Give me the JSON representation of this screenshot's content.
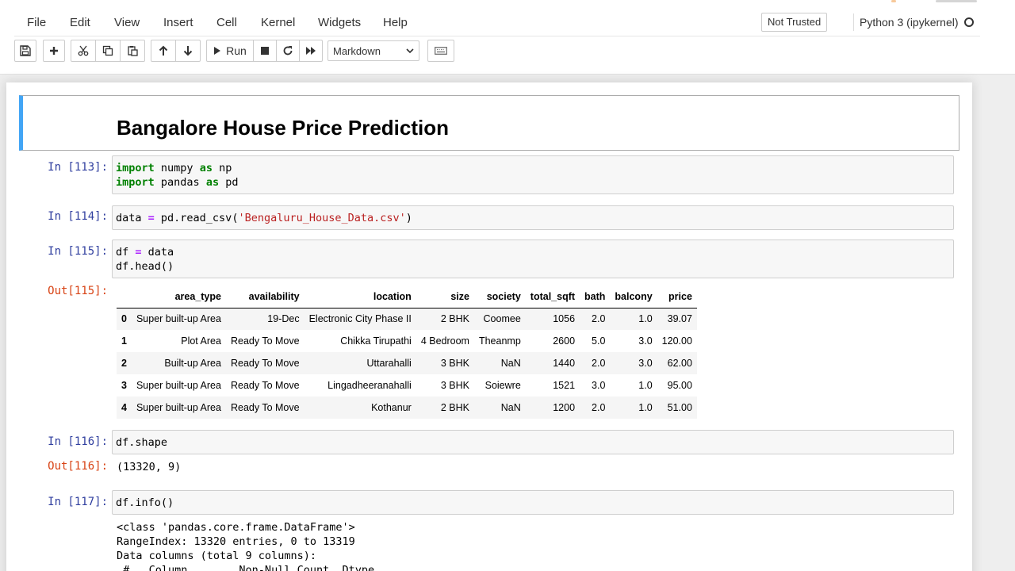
{
  "menu": [
    "File",
    "Edit",
    "View",
    "Insert",
    "Cell",
    "Kernel",
    "Widgets",
    "Help"
  ],
  "header": {
    "trust_label": "Not Trusted",
    "kernel_name": "Python 3 (ipykernel)"
  },
  "toolbar": {
    "run_label": "Run",
    "cell_type": "Markdown",
    "icons": [
      "save-icon",
      "plus-icon",
      "scissors-icon",
      "copy-icon",
      "paste-icon",
      "arrow-up-icon",
      "arrow-down-icon",
      "play-icon",
      "stop-icon",
      "restart-icon",
      "fast-forward-icon",
      "keyboard-icon"
    ]
  },
  "notebook": {
    "heading": "Bangalore House Price Prediction",
    "cells": [
      {
        "prompt": "In [113]:",
        "lines": [
          [
            "kw:import",
            " numpy ",
            "kw:as",
            " np"
          ],
          [
            "kw:import",
            " pandas ",
            "kw:as",
            " pd"
          ]
        ]
      },
      {
        "prompt": "In [114]:",
        "lines": [
          [
            "data ",
            "op:=",
            " pd.read_csv(",
            "str:'Bengaluru_House_Data.csv'",
            ")"
          ]
        ]
      },
      {
        "prompt": "In [115]:",
        "lines": [
          [
            "df ",
            "op:=",
            " data"
          ],
          [
            "df.head()"
          ]
        ]
      },
      {
        "prompt": "In [116]:",
        "lines": [
          [
            "df.shape"
          ]
        ]
      },
      {
        "prompt": "In [117]:",
        "lines": [
          [
            "df.info()"
          ]
        ]
      }
    ],
    "outputs": {
      "out115_prompt": "Out[115]:",
      "out116_prompt": "Out[116]:",
      "out116_text": "(13320, 9)",
      "info_lines": [
        "<class 'pandas.core.frame.DataFrame'>",
        "RangeIndex: 13320 entries, 0 to 13319",
        "Data columns (total 9 columns):",
        " #   Column        Non-Null Count  Dtype"
      ]
    },
    "dataframe": {
      "columns": [
        "",
        "area_type",
        "availability",
        "location",
        "size",
        "society",
        "total_sqft",
        "bath",
        "balcony",
        "price"
      ],
      "rows": [
        [
          "0",
          "Super built-up Area",
          "19-Dec",
          "Electronic City Phase II",
          "2 BHK",
          "Coomee",
          "1056",
          "2.0",
          "1.0",
          "39.07"
        ],
        [
          "1",
          "Plot Area",
          "Ready To Move",
          "Chikka Tirupathi",
          "4 Bedroom",
          "Theanmp",
          "2600",
          "5.0",
          "3.0",
          "120.00"
        ],
        [
          "2",
          "Built-up Area",
          "Ready To Move",
          "Uttarahalli",
          "3 BHK",
          "NaN",
          "1440",
          "2.0",
          "3.0",
          "62.00"
        ],
        [
          "3",
          "Super built-up Area",
          "Ready To Move",
          "Lingadheeranahalli",
          "3 BHK",
          "Soiewre",
          "1521",
          "3.0",
          "1.0",
          "95.00"
        ],
        [
          "4",
          "Super built-up Area",
          "Ready To Move",
          "Kothanur",
          "2 BHK",
          "NaN",
          "1200",
          "2.0",
          "1.0",
          "51.00"
        ]
      ]
    }
  },
  "colors": {
    "selected_cell_border": "#42a5f5",
    "prompt_in": "#303f9f",
    "prompt_out": "#d84315",
    "keyword": "#008000",
    "string": "#ba2121",
    "operator": "#aa22ff"
  }
}
